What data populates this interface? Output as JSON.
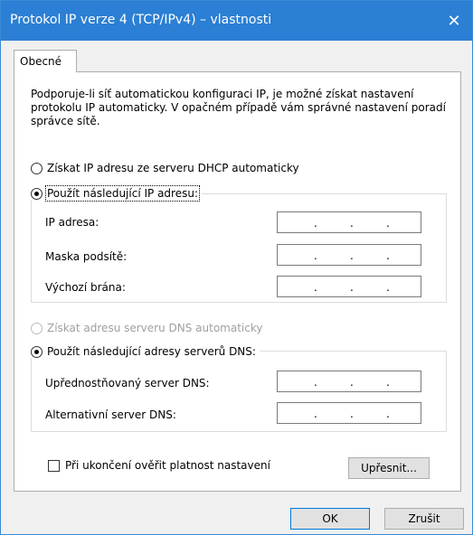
{
  "window": {
    "title": "Protokol IP verze 4 (TCP/IPv4) – vlastnosti",
    "close_glyph": "✕"
  },
  "tabs": [
    {
      "label": "Obecné",
      "selected": true
    }
  ],
  "description": "Podporuje-li síť automatickou konfiguraci IP, je možné získat nastavení protokolu IP automaticky. V opačném případě vám správné nastavení poradí správce sítě.",
  "ip_section": {
    "auto_label": "Získat IP adresu ze serveru DHCP automaticky",
    "manual_label": "Použít následující IP adresu:",
    "selected": "manual",
    "fields": [
      {
        "label": "IP adresa:",
        "value": ". . ."
      },
      {
        "label": "Maska podsítě:",
        "value": ". . ."
      },
      {
        "label": "Výchozí brána:",
        "value": ". . ."
      }
    ]
  },
  "dns_section": {
    "auto_label": "Získat adresu serveru DNS automaticky",
    "manual_label": "Použít následující adresy serverů DNS:",
    "selected": "manual",
    "fields": [
      {
        "label": "Upřednostňovaný server DNS:",
        "value": ". . ."
      },
      {
        "label": "Alternativní server DNS:",
        "value": ". . ."
      }
    ]
  },
  "validate_checkbox": {
    "label": "Při ukončení ověřit platnost nastavení",
    "checked": false
  },
  "buttons": {
    "advanced": "Upřesnit...",
    "ok": "OK",
    "cancel": "Zrušit"
  },
  "colors": {
    "titlebar": "#2b7fd4",
    "window_bg": "#f0f0f0",
    "panel_bg": "#ffffff"
  }
}
